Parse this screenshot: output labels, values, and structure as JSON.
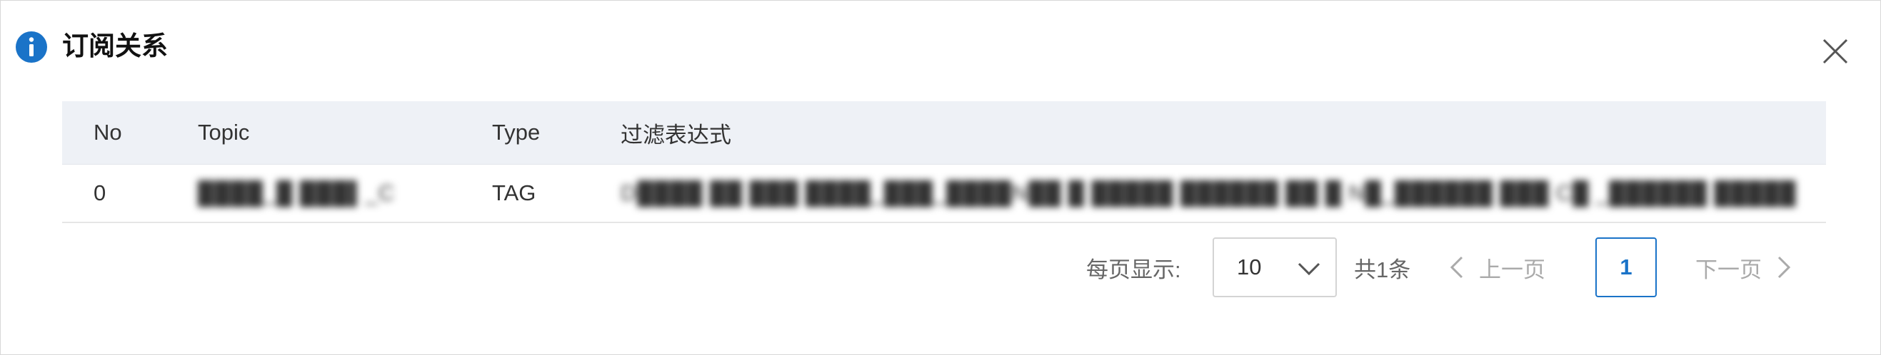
{
  "dialog": {
    "title": "订阅关系",
    "icon": "info-icon",
    "accent_color": "#1a73c8"
  },
  "table": {
    "columns": [
      "No",
      "Topic",
      "Type",
      "过滤表达式"
    ],
    "rows": [
      {
        "no": "0",
        "topic": "████_█ ███▌_C",
        "type": "TAG",
        "expression": "D████ ██ ███ ████_███_████N██ █ █████ ██████ ██ █ N█_██████ ███ C█ _██████ █████"
      }
    ]
  },
  "pagination": {
    "page_size_label": "每页显示:",
    "page_size": "10",
    "total": "共1条",
    "prev_label": "上一页",
    "current_page": "1",
    "next_label": "下一页"
  }
}
